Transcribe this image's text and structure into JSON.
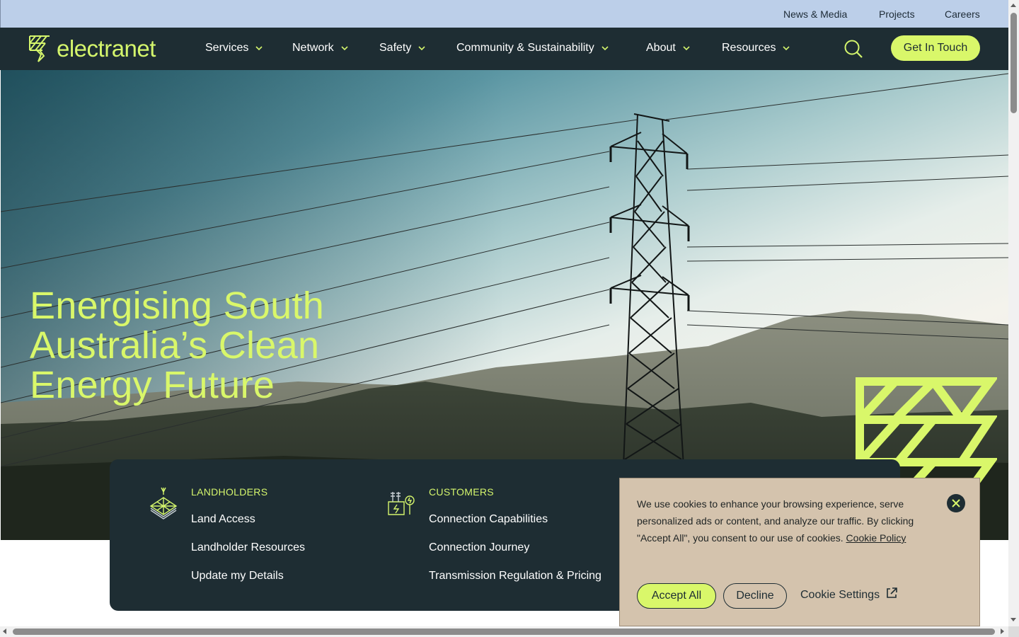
{
  "utility": {
    "links": [
      "News & Media",
      "Projects",
      "Careers"
    ]
  },
  "brand": {
    "name": "electranet"
  },
  "nav": {
    "items": [
      "Services",
      "Network",
      "Safety",
      "Community & Sustainability",
      "About",
      "Resources"
    ],
    "cta": "Get In Touch"
  },
  "hero": {
    "title": "Energising South Australia’s Clean Energy Future"
  },
  "quick_links": {
    "landholders": {
      "heading": "LANDHOLDERS",
      "links": [
        "Land Access",
        "Landholder Resources",
        "Update my Details"
      ]
    },
    "customers": {
      "heading": "CUSTOMERS",
      "links": [
        "Connection Capabilities",
        "Connection Journey",
        "Transmission Regulation & Pricing"
      ]
    }
  },
  "cookie": {
    "text": "We use cookies to enhance your browsing experience, serve personalized ads or content, and analyze our traffic. By clicking \"Accept All\", you consent to our use of cookies.",
    "policy_link": "Cookie Policy",
    "accept": "Accept All",
    "decline": "Decline",
    "settings": "Cookie Settings"
  },
  "colors": {
    "brand_lime": "#d9f76a",
    "nav_dark": "#1e2d33",
    "utility_bg": "#bccfe9",
    "cookie_bg": "#d4c3ad"
  },
  "icons": {
    "search": "search-icon",
    "chevron": "chevron-down-icon",
    "close": "close-icon",
    "external": "external-link-icon",
    "landholders": "land-parcel-icon",
    "customers": "substation-icon"
  }
}
